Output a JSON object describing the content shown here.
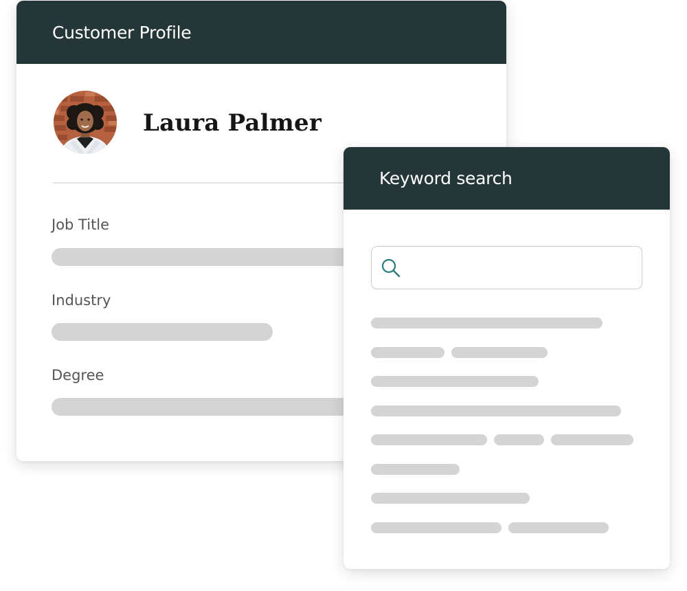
{
  "profile": {
    "title": "Customer Profile",
    "name": "Laura Palmer",
    "avatar_alt": "Customer photo",
    "fields": [
      {
        "label": "Job Title"
      },
      {
        "label": "Industry"
      },
      {
        "label": "Degree"
      }
    ]
  },
  "search": {
    "title": "Keyword search",
    "input_value": "",
    "input_placeholder": "",
    "icon": "search-icon"
  },
  "colors": {
    "header_bg": "#253638",
    "header_text": "#ffffff",
    "skeleton": "#d4d4d4",
    "search_icon": "#2b7b7a"
  }
}
